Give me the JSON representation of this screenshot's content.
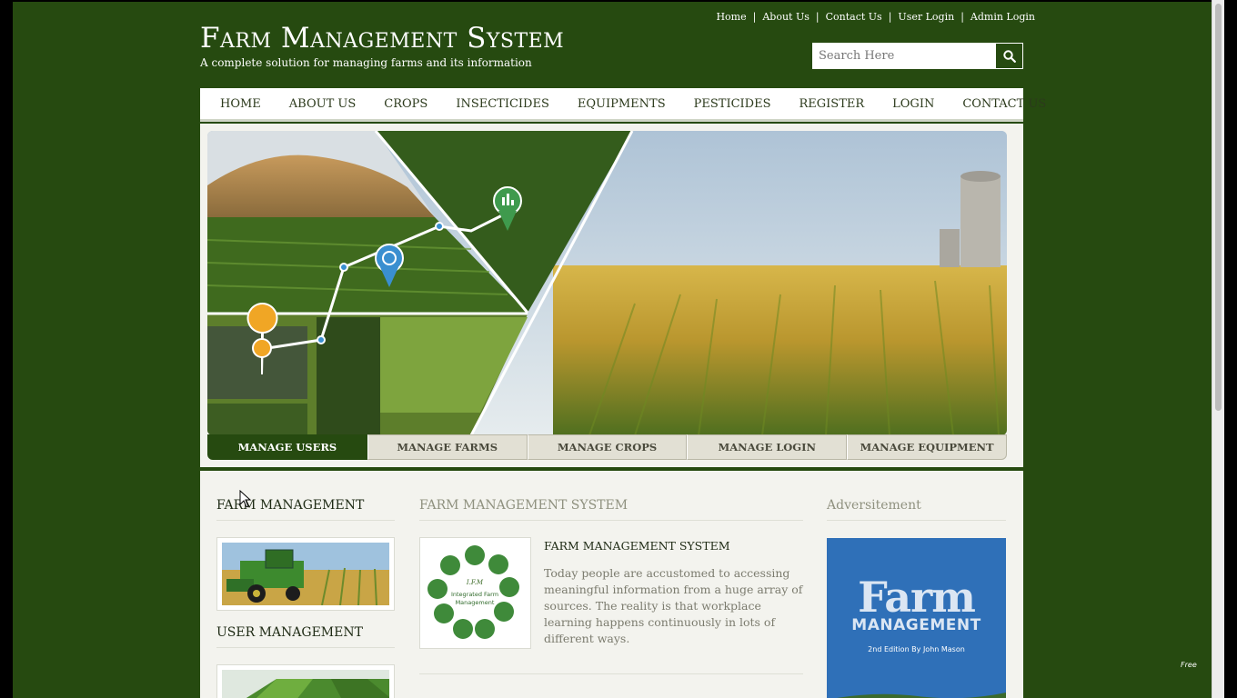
{
  "header": {
    "top_links": [
      "Home",
      "About Us",
      "Contact Us",
      "User Login",
      "Admin Login"
    ],
    "title": "Farm Management System",
    "tagline": "A complete solution for managing farms and its information",
    "search_placeholder": "Search Here"
  },
  "nav": {
    "items": [
      "Home",
      "About Us",
      "Crops",
      "Insecticides",
      "Equipments",
      "Pesticides",
      "Register",
      "Login",
      "Contact Us"
    ]
  },
  "banner": {
    "tabs": [
      "Manage Users",
      "Manage Farms",
      "Manage Crops",
      "Manage Login",
      "Manage Equipment"
    ],
    "active_tab": "Manage Users"
  },
  "content": {
    "left": {
      "title_1": "Farm Management",
      "title_2": "User Management"
    },
    "middle": {
      "section_title": "Farm Management System",
      "logo_text_1": "Integrated Farm",
      "logo_text_2": "Management",
      "logo_abbr": "I.F.M",
      "article_title": "Farm Management System",
      "article_body": "Today people are accustomed to accessing meaningful information from a huge array of sources. The reality is that workplace learning happens continuously in lots of different ways."
    },
    "right": {
      "title": "Adversitement",
      "ad_title": "Farm",
      "ad_subtitle": "MANAGEMENT",
      "ad_edition": "2nd Edition By John Mason"
    }
  },
  "watermark": "Free",
  "colors": {
    "brand_green": "#264a10",
    "panel": "#f3f3ee"
  }
}
